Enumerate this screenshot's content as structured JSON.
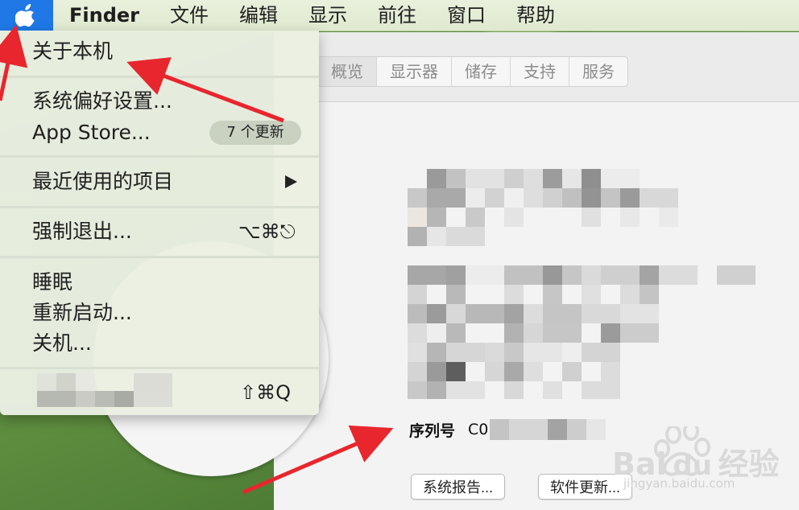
{
  "menubar": {
    "app_name": "Finder",
    "items": [
      "文件",
      "编辑",
      "显示",
      "前往",
      "窗口",
      "帮助"
    ]
  },
  "apple_menu": {
    "about": "关于本机",
    "system_prefs": "系统偏好设置...",
    "app_store": "App Store...",
    "app_store_badge": "7 个更新",
    "recent_items": "最近使用的项目",
    "force_quit": "强制退出...",
    "force_quit_shortcut": "⌥⌘⎋",
    "sleep": "睡眠",
    "restart": "重新启动...",
    "shutdown": "关机...",
    "logout_shortcut": "⇧⌘Q"
  },
  "about_window": {
    "tabs": [
      "概览",
      "显示器",
      "储存",
      "支持",
      "服务"
    ],
    "serial_label": "序列号",
    "serial_value": "C0",
    "system_report_button": "系统报告...",
    "software_update_button": "软件更新..."
  },
  "watermark": {
    "brand": "Bai",
    "brand_du": "du",
    "brand_cn": "经验",
    "url": "jingyan.baidu.com"
  },
  "colors": {
    "apple_menu_highlight": "#1f78e5",
    "annotation_arrow": "#e8262d"
  },
  "icons": [
    "apple-logo-icon",
    "submenu-arrow-icon"
  ]
}
